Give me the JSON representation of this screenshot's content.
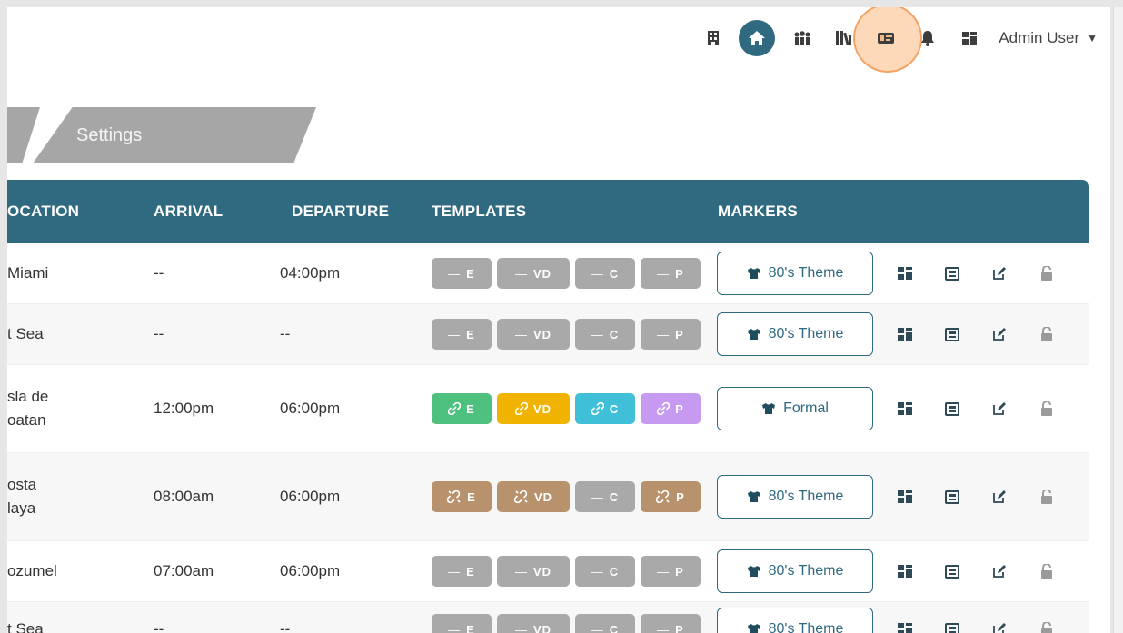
{
  "nav": {
    "user_name": "Admin User"
  },
  "breadcrumb": {
    "current": "Settings"
  },
  "table": {
    "headers": [
      "OCATION",
      "ARRIVAL",
      "DEPARTURE",
      "TEMPLATES",
      "MARKERS"
    ],
    "rows": [
      {
        "location": "Miami",
        "arrival": "--",
        "departure": "04:00pm",
        "templates": [
          {
            "label": "E",
            "state": "none",
            "color": "#a9a9a9"
          },
          {
            "label": "VD",
            "state": "none",
            "color": "#a9a9a9"
          },
          {
            "label": "C",
            "state": "none",
            "color": "#a9a9a9"
          },
          {
            "label": "P",
            "state": "none",
            "color": "#a9a9a9"
          }
        ],
        "marker": "80's Theme"
      },
      {
        "location": "t Sea",
        "arrival": "--",
        "departure": "--",
        "templates": [
          {
            "label": "E",
            "state": "none",
            "color": "#a9a9a9"
          },
          {
            "label": "VD",
            "state": "none",
            "color": "#a9a9a9"
          },
          {
            "label": "C",
            "state": "none",
            "color": "#a9a9a9"
          },
          {
            "label": "P",
            "state": "none",
            "color": "#a9a9a9"
          }
        ],
        "marker": "80's Theme"
      },
      {
        "location": "sla de\noatan",
        "arrival": "12:00pm",
        "departure": "06:00pm",
        "templates": [
          {
            "label": "E",
            "state": "linked",
            "color": "#4fc17e"
          },
          {
            "label": "VD",
            "state": "linked",
            "color": "#f0b400"
          },
          {
            "label": "C",
            "state": "linked",
            "color": "#3fc0d8"
          },
          {
            "label": "P",
            "state": "linked",
            "color": "#c79af2"
          }
        ],
        "marker": "Formal"
      },
      {
        "location": "osta\nlaya",
        "arrival": "08:00am",
        "departure": "06:00pm",
        "templates": [
          {
            "label": "E",
            "state": "unlinked",
            "color": "#b8926c"
          },
          {
            "label": "VD",
            "state": "unlinked",
            "color": "#b8926c"
          },
          {
            "label": "C",
            "state": "none",
            "color": "#a9a9a9"
          },
          {
            "label": "P",
            "state": "unlinked",
            "color": "#b8926c"
          }
        ],
        "marker": "80's Theme"
      },
      {
        "location": "ozumel",
        "arrival": "07:00am",
        "departure": "06:00pm",
        "templates": [
          {
            "label": "E",
            "state": "none",
            "color": "#a9a9a9"
          },
          {
            "label": "VD",
            "state": "none",
            "color": "#a9a9a9"
          },
          {
            "label": "C",
            "state": "none",
            "color": "#a9a9a9"
          },
          {
            "label": "P",
            "state": "none",
            "color": "#a9a9a9"
          }
        ],
        "marker": "80's Theme"
      },
      {
        "location": "t Sea",
        "arrival": "--",
        "departure": "--",
        "templates": [
          {
            "label": "E",
            "state": "none",
            "color": "#a9a9a9"
          },
          {
            "label": "VD",
            "state": "none",
            "color": "#a9a9a9"
          },
          {
            "label": "C",
            "state": "none",
            "color": "#a9a9a9"
          },
          {
            "label": "P",
            "state": "none",
            "color": "#a9a9a9"
          }
        ],
        "marker": "80's Theme"
      }
    ]
  },
  "icons": {
    "nav": [
      "building-icon",
      "home-icon",
      "people-icon",
      "library-icon",
      "id-card-icon",
      "bell-icon",
      "dashboard-icon"
    ],
    "row_actions": [
      "grid-icon",
      "newspaper-icon",
      "edit-icon",
      "unlock-icon"
    ],
    "template_states": {
      "none": "dash-icon",
      "linked": "link-icon",
      "unlinked": "broken-link-icon"
    },
    "marker": "tshirt-icon"
  },
  "colors": {
    "accent": "#2f6a80",
    "header_text": "#ffffff",
    "breadcrumb": "#a6a6a6",
    "highlight": "#f8b47a"
  }
}
